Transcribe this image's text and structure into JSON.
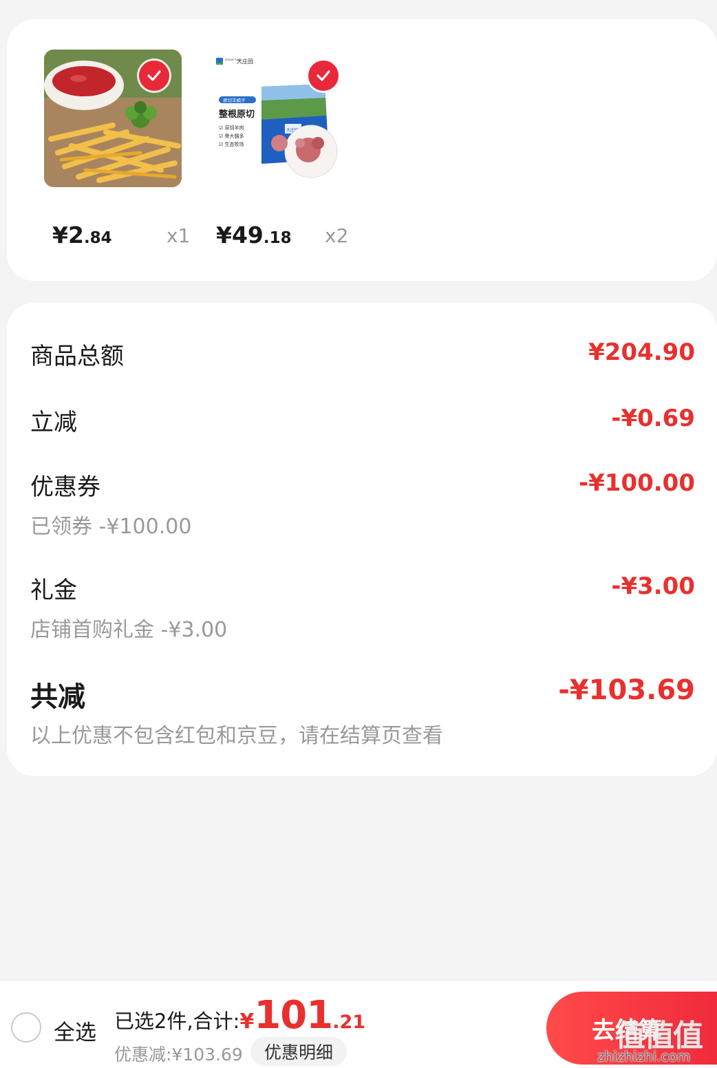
{
  "products": [
    {
      "price_int": "¥2",
      "price_dec": ".84",
      "qty": "x1",
      "image": "french-fries"
    },
    {
      "price_int": "¥49",
      "price_dec": ".18",
      "qty": "x2",
      "image": "lamb-package",
      "package": {
        "brand": "大庄园",
        "brand_en": "Grand Farm",
        "tag": "原切羊蝎子",
        "title": "整根原切",
        "features": [
          "草饲羊肉",
          "骨大髓多",
          "生态牧场"
        ],
        "bag_label": "大庄园"
      }
    }
  ],
  "summary": {
    "goods_total": {
      "label": "商品总额",
      "value": "¥204.90"
    },
    "instant_reduction": {
      "label": "立减",
      "value": "-¥0.69"
    },
    "coupon": {
      "label": "优惠券",
      "value": "-¥100.00",
      "sub": "已领券 -¥100.00"
    },
    "gift": {
      "label": "礼金",
      "value": "-¥3.00",
      "sub": "店铺首购礼金 -¥3.00"
    },
    "total_reduction": {
      "label": "共减",
      "value": "-¥103.69",
      "note": "以上优惠不包含红包和京豆，请在结算页查看"
    }
  },
  "bottom_bar": {
    "select_all": "全选",
    "selected_label": "已选2件,合计:",
    "total_yen": "¥",
    "total_int": "101",
    "total_dec": ".21",
    "discount": "优惠减:¥103.69",
    "detail_button": "优惠明细",
    "checkout_button": "去结算"
  },
  "watermark": {
    "main": "值值值",
    "url": "zhizhizhi.com"
  },
  "colors": {
    "accent": "#e8302e",
    "check": "#e9283a",
    "checkout_start": "#ff4a4a",
    "checkout_end": "#f02b3c"
  }
}
